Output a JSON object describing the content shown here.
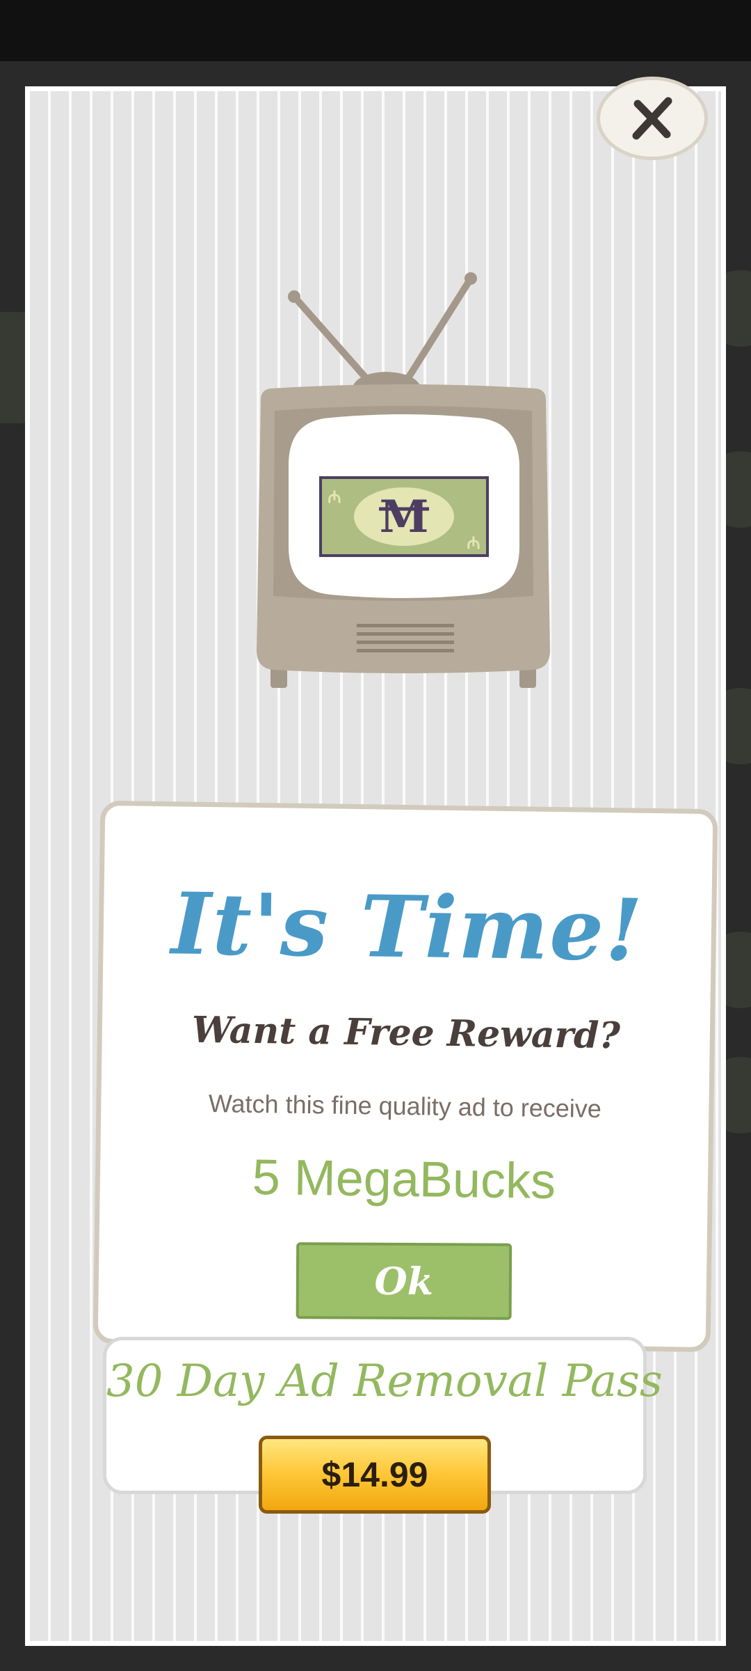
{
  "modal": {
    "close_label": "X",
    "title": "It's Time!",
    "subtitle": "Want a Free Reward?",
    "body": "Watch this fine quality ad to receive",
    "reward": "5 MegaBucks",
    "ok_label": "Ok"
  },
  "pass": {
    "title": "30 Day Ad Removal Pass",
    "price": "$14.99"
  },
  "tv_icon": "tv-with-megabucks-bill",
  "colors": {
    "title_blue": "#4a9ac8",
    "accent_green": "#93b85e",
    "button_green": "#9cc069",
    "price_gold": "#ffc93a",
    "tv_gray": "#b7ab9b",
    "bill_purple": "#4e3d63"
  }
}
